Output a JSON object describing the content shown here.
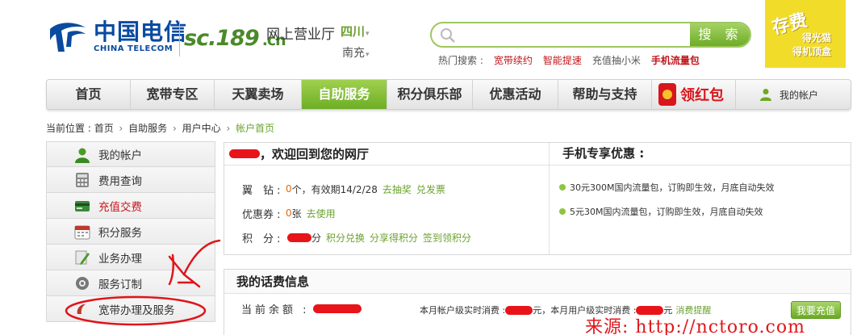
{
  "header": {
    "logo_cn": "中国电信",
    "logo_en": "CHINA TELECOM",
    "site_domain": "sc.189",
    "site_tld": ".cn",
    "site_title": "网上营业厅",
    "province": "四川",
    "city": "南充",
    "search_button": "搜 索",
    "search_placeholder": "",
    "hot_search_label": "热门搜索 :",
    "hot_links": [
      "宽带续约",
      "智能提速",
      "充值抽小米",
      "手机流量包"
    ],
    "promo": {
      "big": "存费",
      "line1": "得光猫",
      "line2": "得机顶盒"
    }
  },
  "nav": {
    "items": [
      "首页",
      "宽带专区",
      "天翼卖场",
      "自助服务",
      "积分俱乐部",
      "优惠活动",
      "帮助与支持"
    ],
    "active_index": 3,
    "hongbao": "领红包",
    "account": "我的帐户"
  },
  "breadcrumb": {
    "prefix": "当前位置 :",
    "items": [
      "首页",
      "自助服务",
      "用户中心"
    ],
    "current": "帐户首页"
  },
  "sidebar": {
    "items": [
      "我的帐户",
      "费用查询",
      "充值交费",
      "积分服务",
      "业务办理",
      "服务订制",
      "宽带办理及服务"
    ],
    "active_index": 2
  },
  "welcome": {
    "greeting": "，欢迎回到您的网厅",
    "wing_label": "翼　钻 :",
    "wing_count": "0",
    "wing_text": "个，有效期14/2/28",
    "wing_links": [
      "去抽奖",
      "兑发票"
    ],
    "coupon_label": "优惠券 :",
    "coupon_count": "0",
    "coupon_text": "张",
    "coupon_link": "去使用",
    "points_label": "积　分 :",
    "points_unit": "分",
    "points_links": [
      "积分兑换",
      "分享得积分",
      "签到领积分"
    ]
  },
  "mobile_offers": {
    "title": "手机专享优惠 :",
    "items": [
      "30元300M国内流量包，订购即生效，月底自动失效",
      "5元30M国内流量包，订购即生效，月底自动失效"
    ]
  },
  "fees": {
    "title": "我的话费信息",
    "balance_label": "当前余额 :",
    "realtime_label_1": "本月帐户级实时消费 :",
    "unit_1": "元，",
    "realtime_label_2": "本月用户级实时消费 :",
    "unit_2": "元",
    "alert_link": "消费提醒",
    "recharge_button": "我要充值"
  },
  "watermark": "来源: http://nctoro.com",
  "colors": {
    "brand_green": "#6eae25",
    "brand_blue": "#0a4aa0",
    "alert_red": "#c8181c",
    "promo_yellow": "#f2dc2a"
  }
}
